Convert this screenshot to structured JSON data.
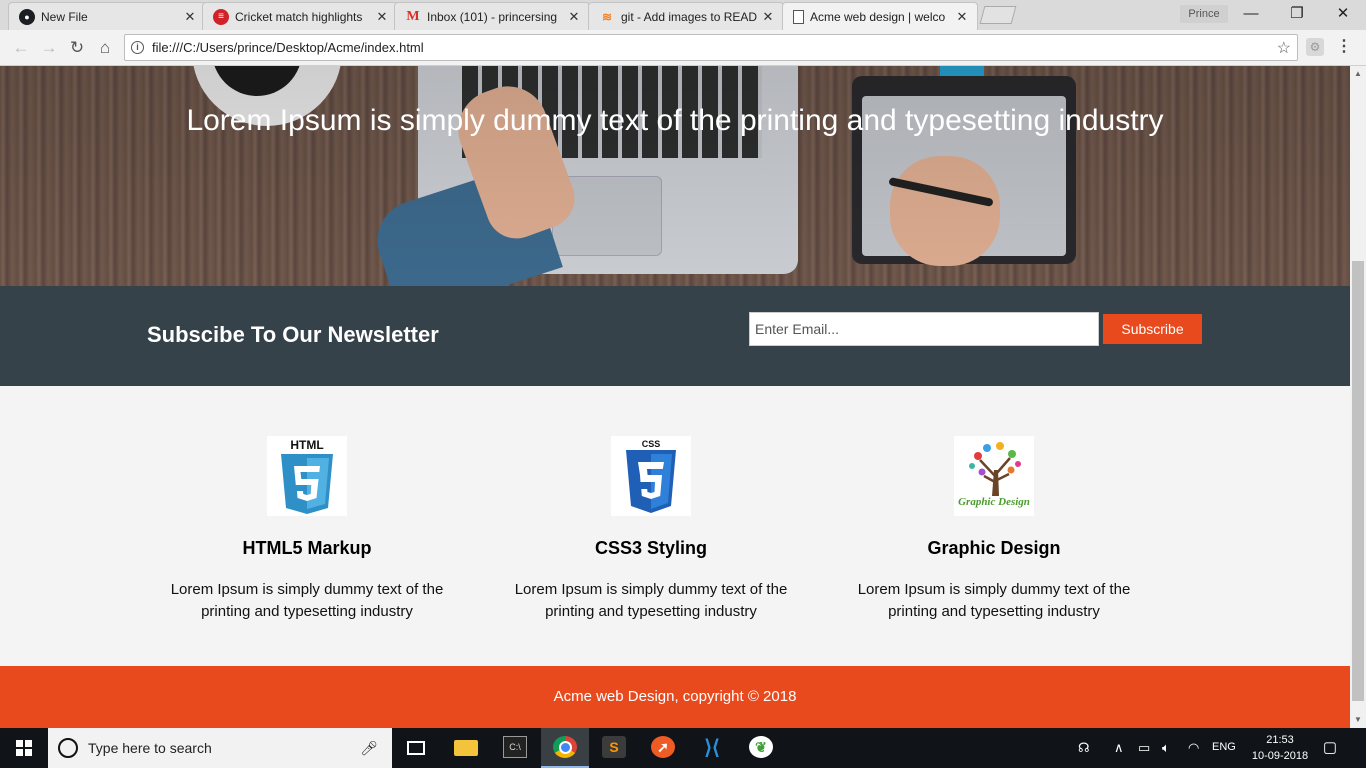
{
  "browser": {
    "tabs": [
      {
        "title": "New File",
        "icon": "github-icon"
      },
      {
        "title": "Cricket match highlights",
        "icon": "cricket-icon"
      },
      {
        "title": "Inbox (101) - princersing",
        "icon": "gmail-icon"
      },
      {
        "title": "git - Add images to READ",
        "icon": "stackoverflow-icon"
      },
      {
        "title": "Acme web design | welco",
        "icon": "document-icon"
      }
    ],
    "profile_label": "Prince",
    "url": "file:///C:/Users/prince/Desktop/Acme/index.html",
    "window_controls": {
      "minimize": "—",
      "maximize": "❐",
      "close": "✕"
    }
  },
  "page": {
    "hero_title": "Lorem Ipsum is simply dummy text of the printing and typesetting industry",
    "newsletter": {
      "title": "Subscibe To Our Newsletter",
      "email_placeholder": "Enter Email...",
      "button_label": "Subscribe"
    },
    "boxes": [
      {
        "icon": "html5-logo",
        "icon_text": "HTML",
        "title": "HTML5 Markup",
        "text": "Lorem Ipsum is simply dummy text of the printing and typesetting industry"
      },
      {
        "icon": "css3-logo",
        "icon_text": "CSS",
        "title": "CSS3 Styling",
        "text": "Lorem Ipsum is simply dummy text of the printing and typesetting industry"
      },
      {
        "icon": "graphic-design-logo",
        "icon_text": "Graphic Design",
        "title": "Graphic Design",
        "text": "Lorem Ipsum is simply dummy text of the printing and typesetting industry"
      }
    ],
    "footer_text": "Acme web Design, copyright © 2018"
  },
  "taskbar": {
    "search_placeholder": "Type here to search",
    "apps": [
      "task-view",
      "file-explorer",
      "command-prompt",
      "chrome",
      "sublime-text",
      "postman",
      "vscode",
      "mongodb-compass"
    ],
    "language": "ENG",
    "time": "21:53",
    "date": "10-09-2018"
  },
  "colors": {
    "accent_orange": "#e8491d",
    "newsletter_bg": "#35424a",
    "page_bg": "#f4f4f4"
  }
}
